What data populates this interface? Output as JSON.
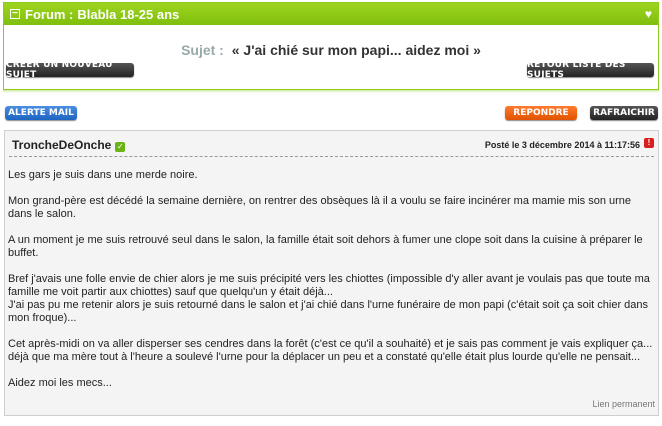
{
  "forum": {
    "label": "Forum :",
    "name": "Blabla 18-25 ans",
    "subject_label": "Sujet :",
    "subject_title": "« J'ai chié sur mon papi... aidez moi »",
    "new_topic_button": "Creer un nouveau sujet",
    "back_button": "Retour liste des sujets"
  },
  "toolbar": {
    "alert_mail": "Alerte mail",
    "reply": "Repondre",
    "refresh": "Rafraichir"
  },
  "post": {
    "author": "TroncheDeOnche",
    "posted": "Posté le 3 décembre 2014 à 11:17:56",
    "paragraphs": [
      "Les gars je suis dans une merde noire.",
      "Mon grand-père est décédé la semaine dernière, on rentrer des obsèques là il a voulu se faire incinérer ma mamie mis son urne dans le salon.",
      "A un moment je me suis retrouvé seul dans le salon, la famille était soit dehors à fumer une clope soit dans la cuisine à préparer le buffet.",
      "Bref j'avais une folle envie de chier alors je me suis précipité vers les chiottes (impossible d'y aller avant je voulais pas que toute ma famille me voit partir aux chiottes) sauf que quelqu'un y était déjà...",
      "J'ai pas pu me retenir alors je suis retourné dans le salon et j'ai chié dans l'urne funéraire de mon papi (c'était soit ça soit chier dans mon froque)...",
      "Cet après-midi on va aller disperser ses cendres dans la forêt (c'est ce qu'il a souhaité) et je sais pas comment je vais expliquer ça... déjà que ma mère tout à l'heure a soulevé l'urne pour la déplacer un peu et a constaté qu'elle était plus lourde qu'elle ne pensait...",
      "Aidez moi les mecs..."
    ],
    "permalink": "Lien permanent"
  },
  "icons": {
    "collapse": "minus-box-icon",
    "favorite": "heart-icon",
    "verified": "check-icon",
    "report": "alert-icon"
  }
}
